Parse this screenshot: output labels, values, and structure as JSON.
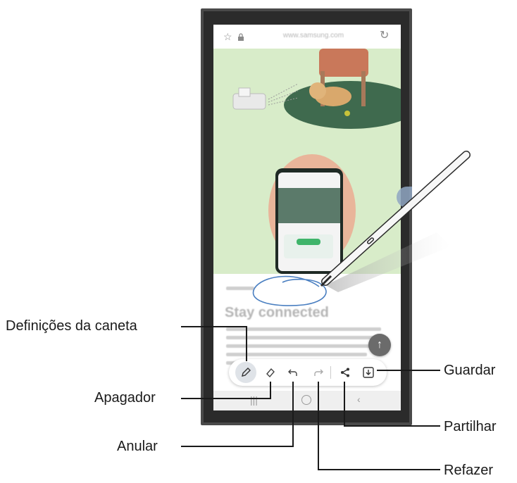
{
  "browser": {
    "url": "www.samsung.com",
    "star_icon": "star-outline-icon",
    "lock_icon": "lock-icon",
    "reload_icon": "reload-icon"
  },
  "article": {
    "heading": "Stay connected"
  },
  "toolbar": {
    "tools": [
      {
        "name": "pen-settings",
        "icon": "pen-icon"
      },
      {
        "name": "eraser",
        "icon": "eraser-icon"
      },
      {
        "name": "undo",
        "icon": "undo-icon"
      },
      {
        "name": "redo",
        "icon": "redo-icon"
      },
      {
        "name": "share",
        "icon": "share-icon"
      },
      {
        "name": "save",
        "icon": "save-icon"
      }
    ]
  },
  "callouts": {
    "pen_settings": "Definições da caneta",
    "eraser": "Apagador",
    "undo": "Anular",
    "save": "Guardar",
    "share": "Partilhar",
    "redo": "Refazer"
  },
  "colors": {
    "hero_background": "#d8ecc9",
    "annotation_stroke": "#4a7fc1",
    "toolbar_active": "#dfe3e8"
  }
}
